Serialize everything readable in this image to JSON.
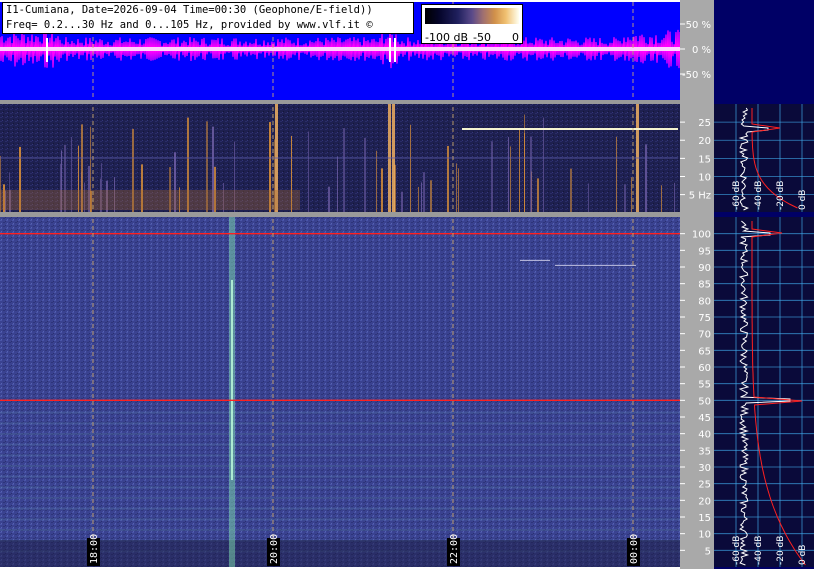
{
  "header": {
    "line1": "I1-Cumiana, Date=2026-09-04 Time=00:30 (Geophone/E-field))",
    "line2": "Freq= 0.2...30 Hz and 0...105 Hz, provided by www.vlf.it ©"
  },
  "colorbar": {
    "labels": [
      "-100 dB",
      "-50",
      "0"
    ]
  },
  "colors": {
    "waveform_bg": "#0000ff",
    "waveform_trace": "#ff00ff",
    "waterfall_bg": "#3a4290",
    "right_panel_bg": "#000066",
    "grid_cyan": "#3fa7e8",
    "marker_red": "#ff2020",
    "time_grid": "#d4b070"
  },
  "chart_data": [
    {
      "type": "line",
      "panel": "waveform",
      "yticks": [
        "50 %",
        "0 %",
        "-50 %"
      ],
      "ytick_values": [
        50,
        0,
        -50
      ],
      "ylim": [
        -100,
        100
      ]
    },
    {
      "type": "heatmap",
      "panel": "spectrogram-low",
      "frequency_range_hz": [
        0.2,
        30
      ],
      "yticks": [
        "25",
        "20",
        "15",
        "10",
        "5 Hz"
      ],
      "ytick_values": [
        25,
        20,
        15,
        10,
        5
      ],
      "ylim": [
        0.2,
        30
      ]
    },
    {
      "type": "heatmap",
      "panel": "spectrogram-high",
      "frequency_range_hz": [
        0,
        105
      ],
      "yticks": [
        "100",
        "95",
        "90",
        "85",
        "80",
        "75",
        "70",
        "65",
        "60",
        "55",
        "50",
        "45",
        "40",
        "35",
        "30",
        "25",
        "20",
        "15",
        "10",
        "5"
      ],
      "ytick_values": [
        100,
        95,
        90,
        85,
        80,
        75,
        70,
        65,
        60,
        55,
        50,
        45,
        40,
        35,
        30,
        25,
        20,
        15,
        10,
        5
      ],
      "ylim": [
        0,
        105
      ],
      "markers_hz": [
        100,
        50
      ],
      "time_labels": [
        "18:00",
        "20:00",
        "22:00",
        "00:00"
      ]
    },
    {
      "type": "line",
      "panel": "spectrum-low",
      "xticks": [
        "-60 dB",
        "-40 dB",
        "-20 dB",
        "0 dB"
      ]
    },
    {
      "type": "line",
      "panel": "spectrum-high",
      "xticks": [
        "-60 dB",
        "-40 dB",
        "-20 dB",
        "0 dB"
      ]
    }
  ]
}
